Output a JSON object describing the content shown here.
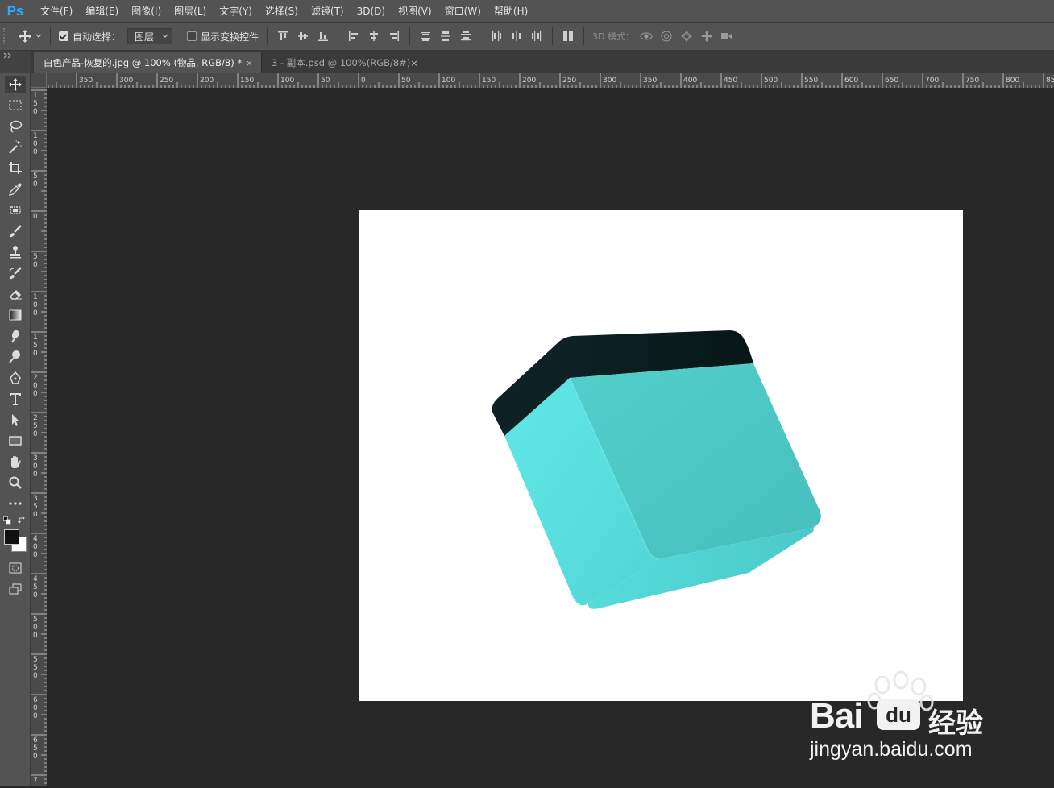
{
  "app": {
    "logo": "Ps",
    "menu": [
      "文件(F)",
      "编辑(E)",
      "图像(I)",
      "图层(L)",
      "文字(Y)",
      "选择(S)",
      "滤镜(T)",
      "3D(D)",
      "视图(V)",
      "窗口(W)",
      "帮助(H)"
    ]
  },
  "options": {
    "auto_select_label": "自动选择：",
    "auto_select_checked": true,
    "auto_select_target": "图层",
    "show_transform_label": "显示变换控件",
    "show_transform_checked": false,
    "mode_3d_label": "3D 模式："
  },
  "tabs": [
    {
      "title": "白色产品-恢复的.jpg @ 100% (物品, RGB/8) *",
      "close": "×",
      "active": true
    },
    {
      "title": "3 - 副本.psd @ 100%(RGB/8#)",
      "close": "×",
      "active": false
    }
  ],
  "ruler": {
    "h_labels": [
      "350",
      "300",
      "250",
      "200",
      "150",
      "100",
      "50",
      "0",
      "50",
      "100",
      "150",
      "200",
      "250",
      "300",
      "350",
      "400",
      "450",
      "500",
      "550",
      "600",
      "650",
      "700",
      "750",
      "800",
      "85"
    ],
    "v_labels": [
      "150",
      "100",
      "50",
      "0",
      "50",
      "100",
      "150",
      "200",
      "250",
      "300",
      "350",
      "400",
      "450",
      "500",
      "550",
      "600",
      "650",
      "7"
    ]
  },
  "colors": {
    "chrome": "#535353",
    "workspace": "#282828",
    "ps_blue": "#31a8ff",
    "box_cyan": "#5ad9d6",
    "box_lid": "#0f2326"
  },
  "watermark": {
    "brand": "Bai",
    "brand_suffix": "经验",
    "url": "jingyan.baidu.com"
  }
}
